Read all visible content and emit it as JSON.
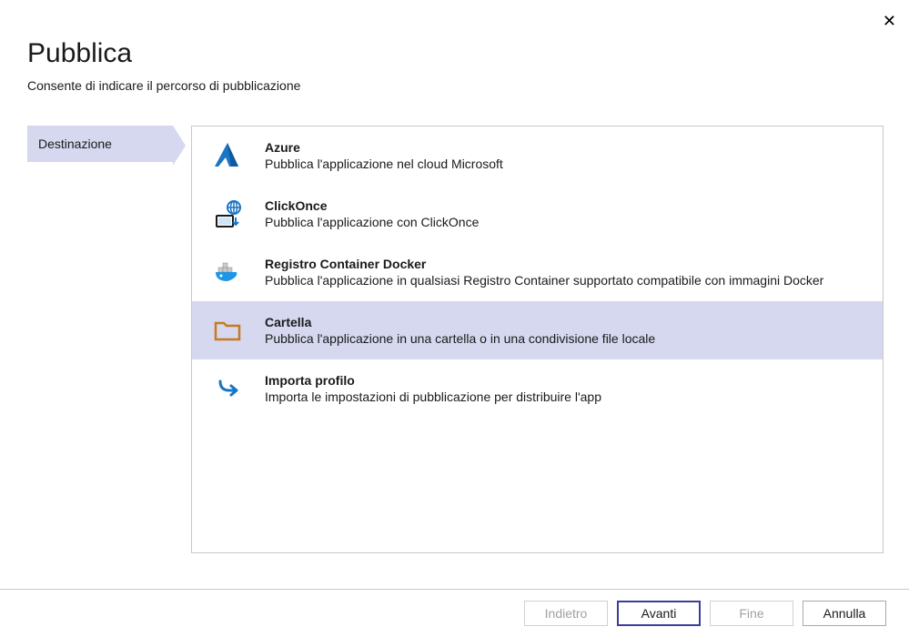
{
  "dialog": {
    "title": "Pubblica",
    "subtitle": "Consente di indicare il percorso di pubblicazione"
  },
  "sidebar": {
    "tabs": [
      {
        "label": "Destinazione",
        "active": true
      }
    ]
  },
  "options": [
    {
      "icon": "azure-icon",
      "title": "Azure",
      "description": "Pubblica l'applicazione nel cloud Microsoft",
      "selected": false
    },
    {
      "icon": "clickonce-icon",
      "title": "ClickOnce",
      "description": "Pubblica l'applicazione con ClickOnce",
      "selected": false
    },
    {
      "icon": "docker-icon",
      "title": "Registro Container Docker",
      "description": "Pubblica l'applicazione in qualsiasi Registro Container supportato compatibile con immagini Docker",
      "selected": false
    },
    {
      "icon": "folder-icon",
      "title": "Cartella",
      "description": "Pubblica l'applicazione in una cartella o in una condivisione file locale",
      "selected": true
    },
    {
      "icon": "import-icon",
      "title": "Importa profilo",
      "description": "Importa le impostazioni di pubblicazione per distribuire l'app",
      "selected": false
    }
  ],
  "footer": {
    "back": "Indietro",
    "next": "Avanti",
    "finish": "Fine",
    "cancel": "Annulla"
  }
}
